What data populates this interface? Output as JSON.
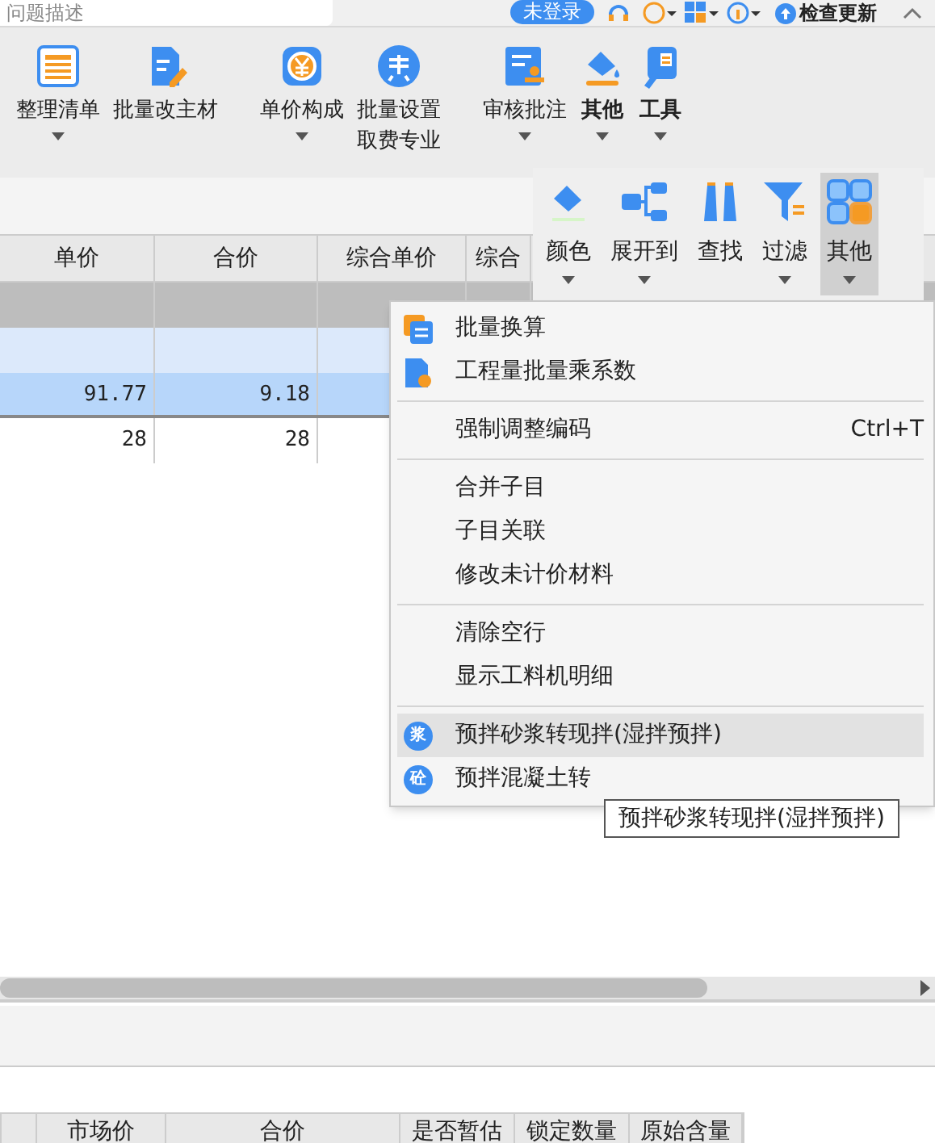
{
  "top_bar": {
    "search": {
      "placeholder": "问题描述"
    },
    "login_badge": "未登录",
    "update_button": "检查更新"
  },
  "ribbon": [
    {
      "label": "整理清单",
      "kind": "list",
      "dropdown": true
    },
    {
      "label": "批量改主材",
      "kind": "edit",
      "dropdown": false
    },
    {
      "label": "单价构成",
      "kind": "yuan",
      "dropdown": true
    },
    {
      "label": "批量设置",
      "sublabel": "取费专业",
      "kind": "fee",
      "dropdown": false
    },
    {
      "label": "审核批注",
      "kind": "stamp",
      "dropdown": true
    },
    {
      "label": "其他",
      "kind": "bucket",
      "dropdown": true
    },
    {
      "label": "工具",
      "kind": "tools",
      "dropdown": true
    }
  ],
  "secondary_toolbar": [
    {
      "label": "颜色",
      "kind": "paint",
      "dropdown": true,
      "selected": false
    },
    {
      "label": "展开到",
      "kind": "tree",
      "dropdown": true,
      "selected": false
    },
    {
      "label": "查找",
      "kind": "find",
      "dropdown": false,
      "selected": false
    },
    {
      "label": "过滤",
      "kind": "filter",
      "dropdown": true,
      "selected": false
    },
    {
      "label": "其他",
      "kind": "grid",
      "dropdown": true,
      "selected": true
    }
  ],
  "table": {
    "columns": [
      "单价",
      "合价",
      "综合单价",
      "综合"
    ],
    "rows": [
      {
        "kind": "group"
      },
      {
        "kind": "subgroup"
      },
      {
        "kind": "item",
        "selected": true,
        "cells": [
          "91.77",
          "9.18"
        ]
      },
      {
        "kind": "item",
        "selected": false,
        "cells": [
          "28",
          "28"
        ]
      }
    ]
  },
  "context_menu": {
    "sections": [
      [
        {
          "label": "批量换算",
          "kind": "convert",
          "selected": false
        },
        {
          "label": "工程量批量乘系数",
          "kind": "multiply",
          "selected": false
        }
      ],
      [
        {
          "label": "强制调整编码",
          "shortcut": "Ctrl+T",
          "selected": false
        }
      ],
      [
        {
          "label": "合并子目",
          "selected": false
        },
        {
          "label": "子目关联",
          "selected": false
        },
        {
          "label": "修改未计价材料",
          "selected": false
        }
      ],
      [
        {
          "label": "清除空行",
          "selected": false
        },
        {
          "label": "显示工料机明细",
          "selected": false
        }
      ],
      [
        {
          "label": "预拌砂浆转现拌(湿拌预拌)",
          "kind": "mortar",
          "badge": "浆",
          "selected": true
        },
        {
          "label": "预拌混凝土转",
          "kind": "concrete",
          "badge": "砼",
          "selected": false
        }
      ]
    ]
  },
  "tooltip": "预拌砂浆转现拌(湿拌预拌)",
  "bottom_table": {
    "columns": [
      "市场价",
      "合价",
      "是否暂估",
      "锁定数量",
      "原始含量"
    ]
  }
}
